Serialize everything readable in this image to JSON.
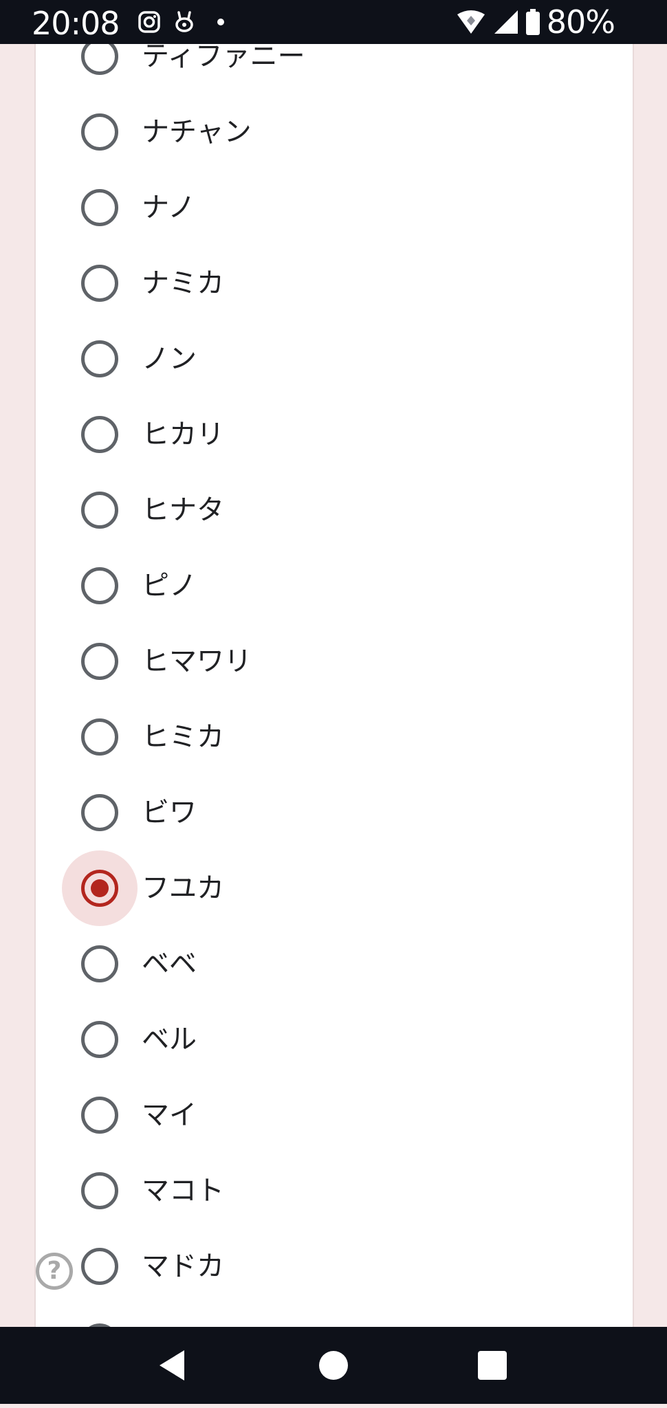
{
  "status_bar": {
    "time": "20:08",
    "battery": "80%",
    "left_icons": [
      "instagram-icon",
      "cat-app-icon",
      "dot-icon"
    ],
    "right_icons": [
      "wifi-icon",
      "signal-icon",
      "battery-icon"
    ]
  },
  "options": [
    {
      "label": "ティファニー",
      "selected": false
    },
    {
      "label": "ナチャン",
      "selected": false
    },
    {
      "label": "ナノ",
      "selected": false
    },
    {
      "label": "ナミカ",
      "selected": false
    },
    {
      "label": "ノン",
      "selected": false
    },
    {
      "label": "ヒカリ",
      "selected": false
    },
    {
      "label": "ヒナタ",
      "selected": false
    },
    {
      "label": "ピノ",
      "selected": false
    },
    {
      "label": "ヒマワリ",
      "selected": false
    },
    {
      "label": "ヒミカ",
      "selected": false
    },
    {
      "label": "ビワ",
      "selected": false
    },
    {
      "label": "フユカ",
      "selected": true
    },
    {
      "label": "ベベ",
      "selected": false
    },
    {
      "label": "ベル",
      "selected": false
    },
    {
      "label": "マイ",
      "selected": false
    },
    {
      "label": "マコト",
      "selected": false
    },
    {
      "label": "マドカ",
      "selected": false
    },
    {
      "label": "",
      "selected": false
    }
  ],
  "help": {
    "glyph": "?",
    "icon": "help-icon"
  },
  "colors": {
    "accent": "#b3261e",
    "selected_halo": "#f4dede",
    "radio_unselected": "#5f6368",
    "page_bg": "#f5e8e8",
    "system_bar": "#0e1119"
  },
  "nav_bar": {
    "buttons": [
      "back-icon",
      "home-icon",
      "recents-icon"
    ]
  }
}
